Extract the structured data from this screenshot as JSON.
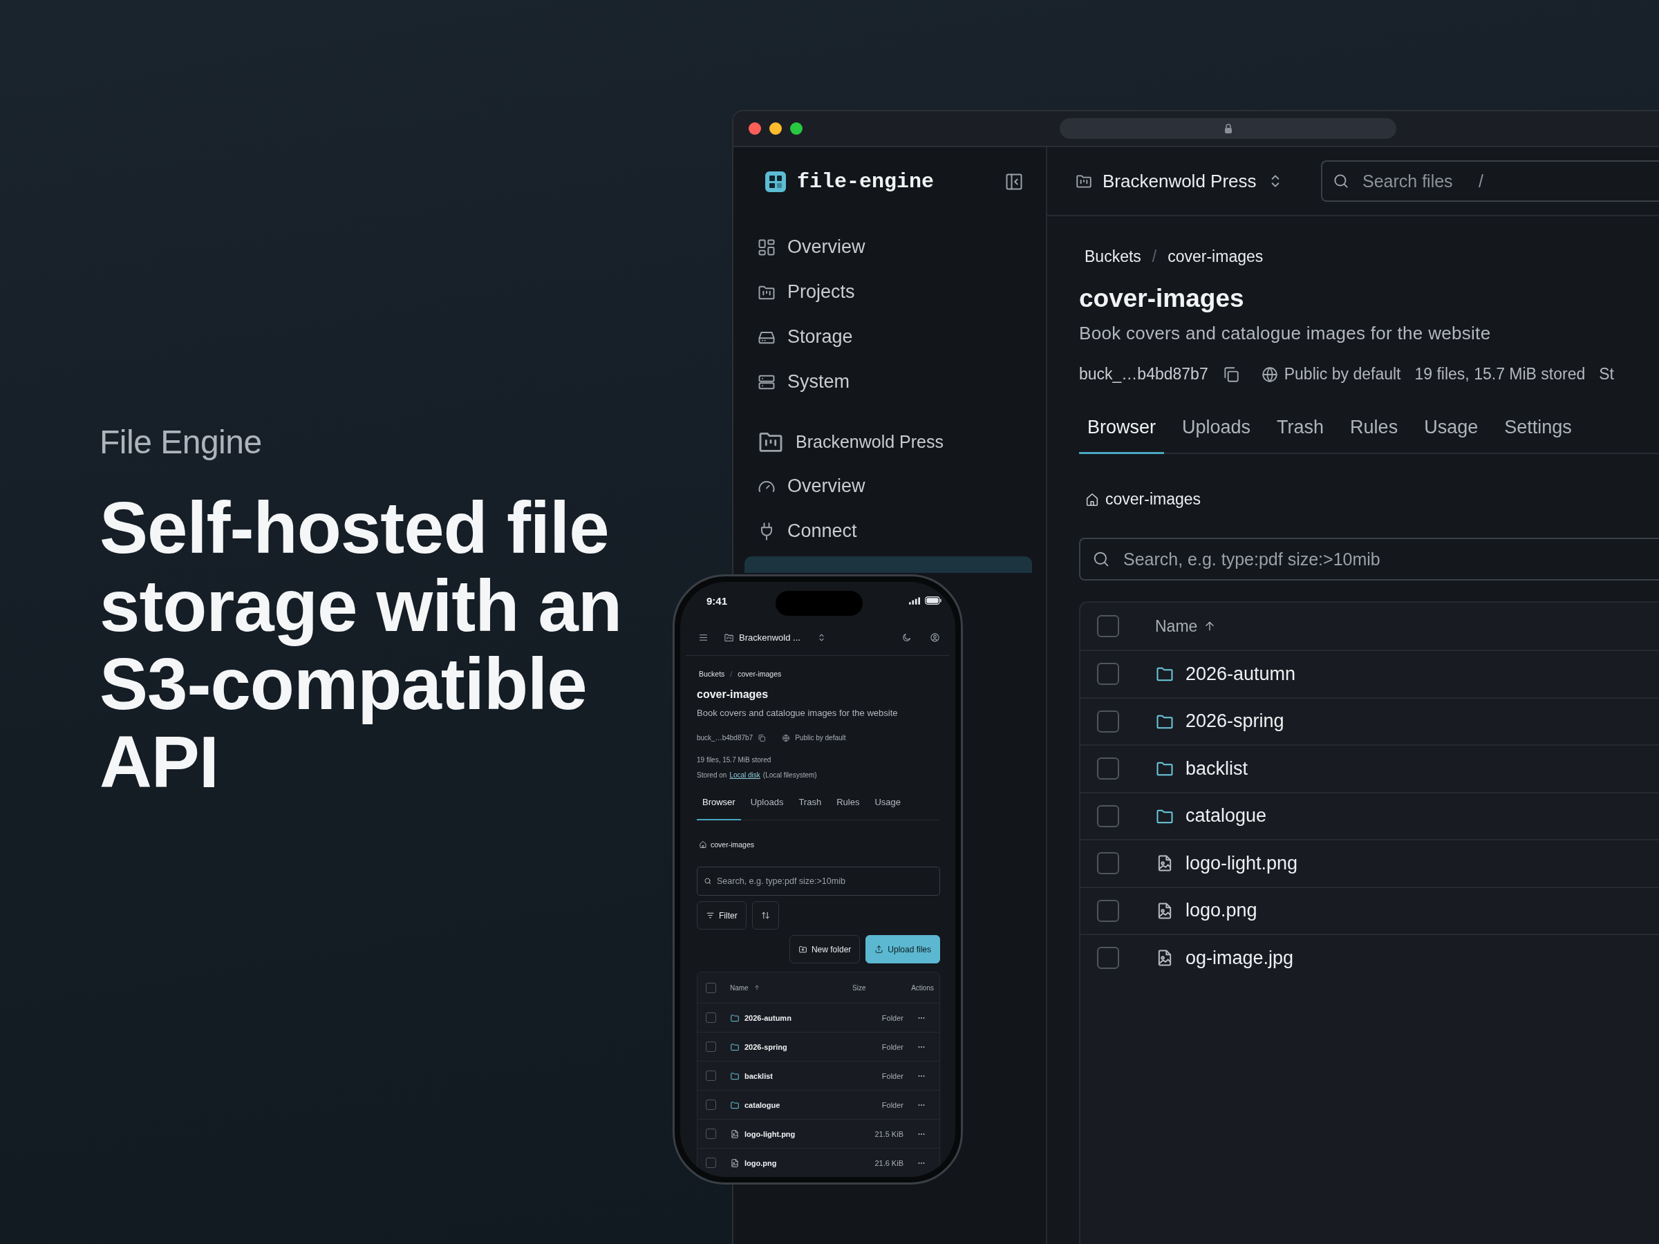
{
  "promo": {
    "eyebrow": "File Engine",
    "headline": "Self-hosted file storage with an S3-compatible API"
  },
  "desktop": {
    "sidebar": {
      "logo": "file-engine",
      "nav": [
        {
          "label": "Overview",
          "selected": false
        },
        {
          "label": "Projects",
          "selected": false
        },
        {
          "label": "Storage",
          "selected": false
        },
        {
          "label": "System",
          "selected": false
        }
      ],
      "project": "Brackenwold Press",
      "project_nav": [
        {
          "label": "Overview",
          "selected": false
        },
        {
          "label": "Connect",
          "selected": false
        },
        {
          "selected": true
        }
      ]
    },
    "header": {
      "project": "Brackenwold Press",
      "search": {
        "placeholder": "Search files",
        "shortcut": "/"
      }
    },
    "breadcrumbs": {
      "items": [
        "Buckets",
        "cover-images"
      ],
      "separator": "/"
    },
    "title": "cover-images",
    "description": "Book covers and catalogue images for the website",
    "meta": {
      "bucket_id": "buck_…b4bd87b7",
      "visibility": "Public by default",
      "stats": "19 files, 15.7 MiB stored",
      "storage": "St"
    },
    "tabs": [
      {
        "label": "Browser",
        "selected": true
      },
      {
        "label": "Uploads",
        "selected": false
      },
      {
        "label": "Trash",
        "selected": false
      },
      {
        "label": "Rules",
        "selected": false
      },
      {
        "label": "Usage",
        "selected": false
      },
      {
        "label": "Settings",
        "selected": false
      }
    ],
    "path": "cover-images",
    "search": {
      "placeholder": "Search, e.g. type:pdf size:>10mib"
    },
    "table": {
      "select_all": {
        "checked": false
      },
      "columns": [
        {
          "label": "Name",
          "sorted_ascending": true
        }
      ],
      "rows": [
        {
          "kind": "folder",
          "name": "2026-autumn",
          "checked": false
        },
        {
          "kind": "folder",
          "name": "2026-spring",
          "checked": false
        },
        {
          "kind": "folder",
          "name": "backlist",
          "checked": false
        },
        {
          "kind": "folder",
          "name": "catalogue",
          "checked": false
        },
        {
          "kind": "image",
          "name": "logo-light.png",
          "checked": false
        },
        {
          "kind": "image",
          "name": "logo.png",
          "checked": false
        },
        {
          "kind": "image",
          "name": "og-image.jpg",
          "checked": false
        }
      ]
    }
  },
  "phone": {
    "status_bar": {
      "time": "9:41"
    },
    "header": {
      "project": "Brackenwold ..."
    },
    "breadcrumbs": {
      "items": [
        "Buckets",
        "cover-images"
      ],
      "separator": "/"
    },
    "title": "cover-images",
    "description": "Book covers and catalogue images for the website",
    "meta": {
      "bucket_id": "buck_…b4bd87b7",
      "visibility": "Public by default",
      "stats": "19 files, 15.7 MiB stored",
      "storage": {
        "prefix": "Stored on",
        "link": "Local disk",
        "suffix": "(Local filesystem)"
      }
    },
    "tabs": [
      {
        "label": "Browser",
        "selected": true
      },
      {
        "label": "Uploads",
        "selected": false
      },
      {
        "label": "Trash",
        "selected": false
      },
      {
        "label": "Rules",
        "selected": false
      },
      {
        "label": "Usage",
        "selected": false
      }
    ],
    "path": "cover-images",
    "search": {
      "placeholder": "Search, e.g. type:pdf size:>10mib"
    },
    "buttons": {
      "filter": "Filter",
      "new_folder": "New folder",
      "upload": "Upload files"
    },
    "table": {
      "select_all": {
        "checked": false
      },
      "columns": [
        {
          "label": "Name",
          "sorted_ascending": true
        },
        {
          "label": "Size"
        },
        {
          "label": "Actions"
        }
      ],
      "rows": [
        {
          "kind": "folder",
          "name": "2026-autumn",
          "size": "Folder",
          "checked": false
        },
        {
          "kind": "folder",
          "name": "2026-spring",
          "size": "Folder",
          "checked": false
        },
        {
          "kind": "folder",
          "name": "backlist",
          "size": "Folder",
          "checked": false
        },
        {
          "kind": "folder",
          "name": "catalogue",
          "size": "Folder",
          "checked": false
        },
        {
          "kind": "image",
          "name": "logo-light.png",
          "size": "21.5 KiB",
          "checked": false
        },
        {
          "kind": "image",
          "name": "logo.png",
          "size": "21.6 KiB",
          "checked": false
        }
      ]
    }
  }
}
